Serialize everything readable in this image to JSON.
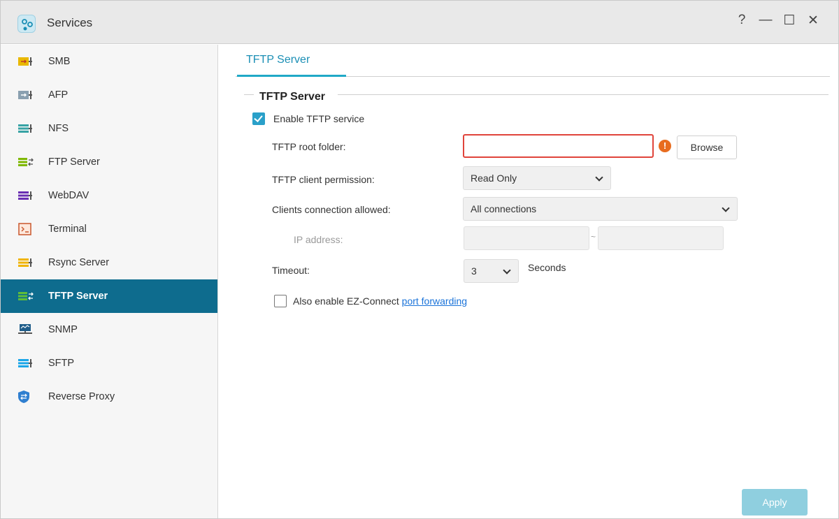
{
  "window": {
    "title": "Services",
    "controls": {
      "help": "?",
      "minimize": "—",
      "maximize": "☐",
      "close": "✕"
    }
  },
  "sidebar": {
    "items": [
      {
        "label": "SMB",
        "icon": "smb-icon",
        "color": "#e9b800"
      },
      {
        "label": "AFP",
        "icon": "afp-icon",
        "color": "#8aa0b0"
      },
      {
        "label": "NFS",
        "icon": "nfs-icon",
        "color": "#38a3a5"
      },
      {
        "label": "FTP Server",
        "icon": "ftp-icon",
        "color": "#7fb800"
      },
      {
        "label": "WebDAV",
        "icon": "webdav-icon",
        "color": "#6a2fb3"
      },
      {
        "label": "Terminal",
        "icon": "terminal-icon",
        "color": "#c9572c"
      },
      {
        "label": "Rsync Server",
        "icon": "rsync-icon",
        "color": "#f0b400"
      },
      {
        "label": "TFTP Server",
        "icon": "tftp-icon",
        "color": "#5fbd3a",
        "active": true
      },
      {
        "label": "SNMP",
        "icon": "snmp-icon",
        "color": "#1f5d8a"
      },
      {
        "label": "SFTP",
        "icon": "sftp-icon",
        "color": "#1aa6e8"
      },
      {
        "label": "Reverse Proxy",
        "icon": "shield-icon",
        "color": "#2f7fd0"
      }
    ]
  },
  "tabs": [
    {
      "label": "TFTP Server"
    }
  ],
  "section": {
    "title": "TFTP Server",
    "enable_label": "Enable TFTP service",
    "root_folder_label": "TFTP root folder:",
    "root_folder_value": "",
    "browse_label": "Browse",
    "warning_glyph": "!",
    "permission_label": "TFTP client permission:",
    "permission_value": "Read Only",
    "clients_label": "Clients connection allowed:",
    "clients_value": "All connections",
    "ip_label": "IP address:",
    "ip_separator": "~",
    "timeout_label": "Timeout:",
    "timeout_value": "3",
    "timeout_unit": "Seconds",
    "ezconnect_prefix": "Also enable EZ-Connect",
    "ezconnect_link": "port forwarding"
  },
  "footer": {
    "apply_label": "Apply"
  },
  "colors": {
    "accent": "#20a9c7",
    "active_sidebar": "#0e6c8e",
    "error": "#e0443b",
    "warning": "#e86c1f"
  }
}
